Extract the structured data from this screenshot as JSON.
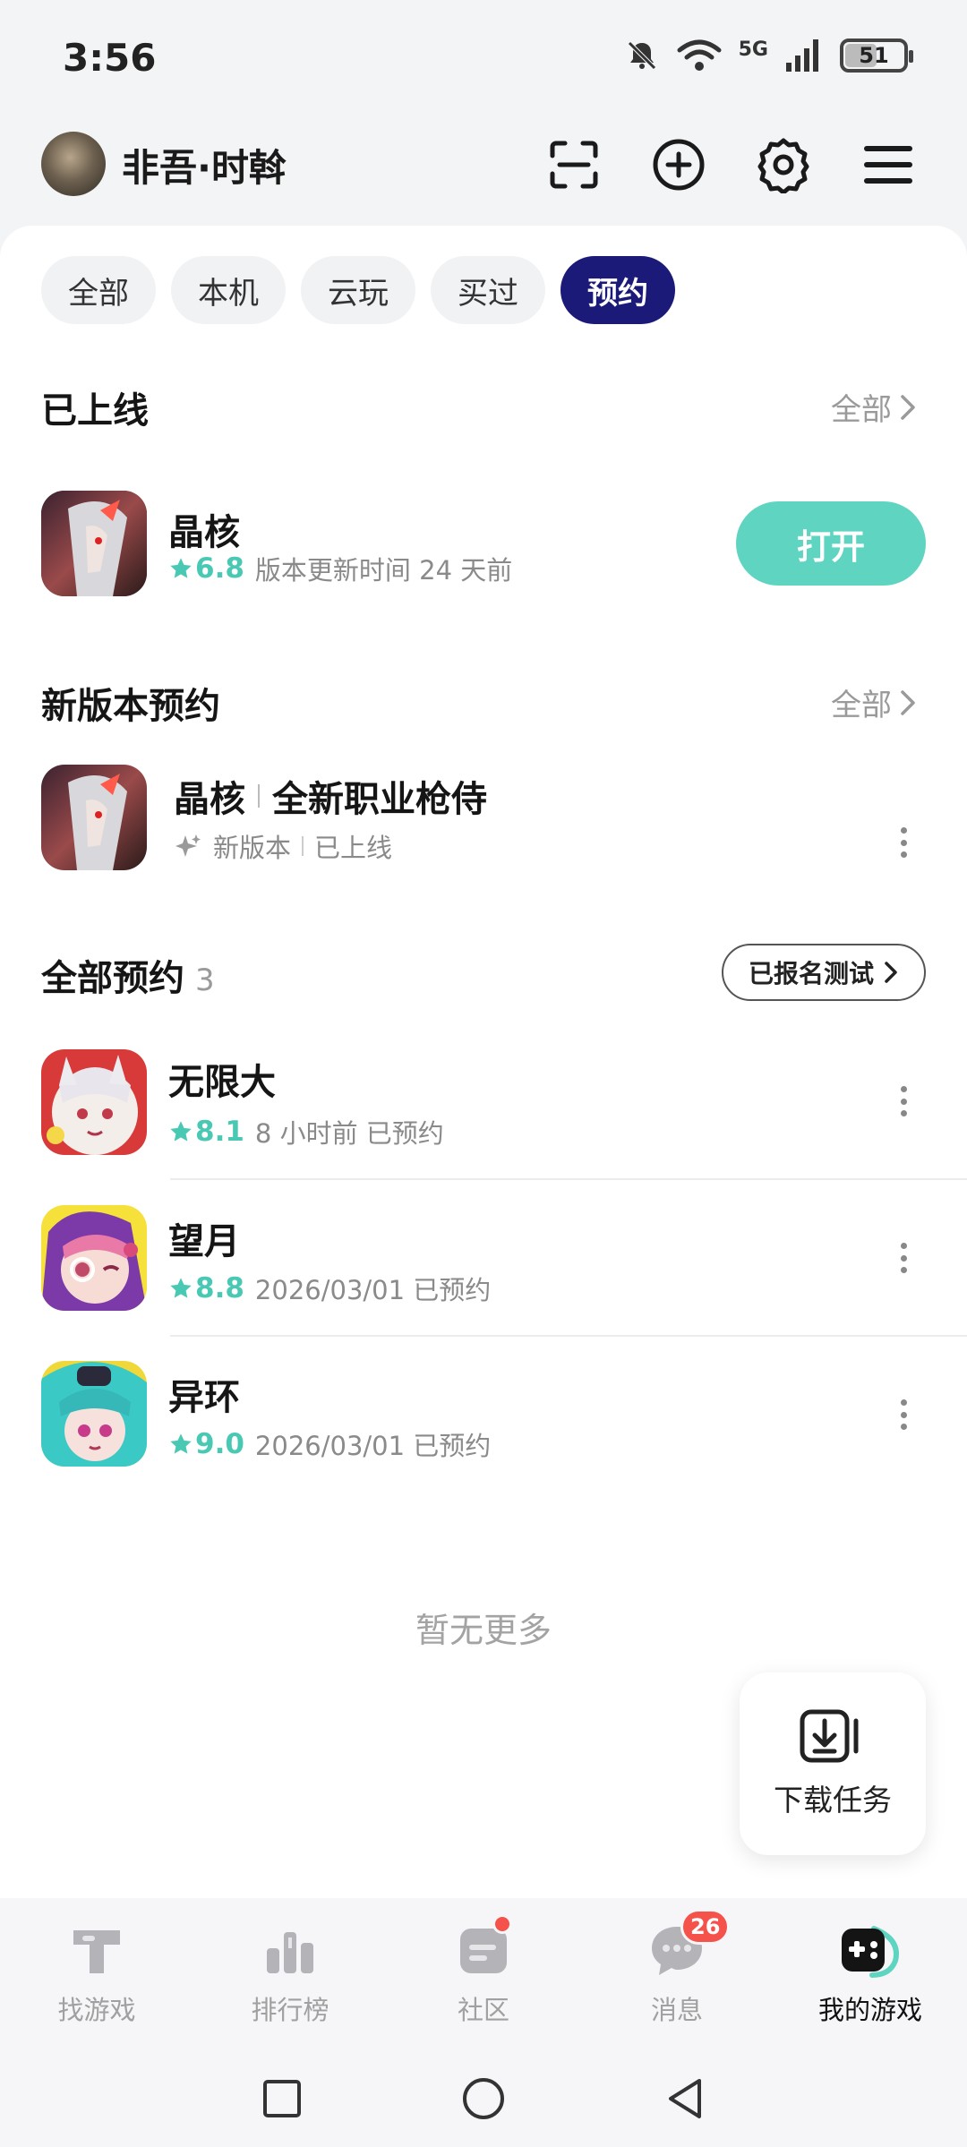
{
  "status_bar": {
    "time": "3:56",
    "network": "5G",
    "battery": "51"
  },
  "header": {
    "user_name": "非吾·时斡"
  },
  "filter_chips": [
    "全部",
    "本机",
    "云玩",
    "买过",
    "预约"
  ],
  "online_section": {
    "title": "已上线",
    "more": "全部",
    "game": {
      "name": "晶核",
      "rating": "6.8",
      "meta": "版本更新时间 24 天前",
      "button": "打开"
    }
  },
  "new_version_section": {
    "title": "新版本预约",
    "more": "全部",
    "game": {
      "name": "晶核",
      "subtitle": "全新职业枪侍",
      "tag1": "新版本",
      "tag2": "已上线"
    }
  },
  "all_reservations": {
    "title": "全部预约",
    "count": "3",
    "signed_button": "已报名测试",
    "games": [
      {
        "name": "无限大",
        "rating": "8.1",
        "meta": "8 小时前 已预约"
      },
      {
        "name": "望月",
        "rating": "8.8",
        "meta": "2026/03/01 已预约"
      },
      {
        "name": "异环",
        "rating": "9.0",
        "meta": "2026/03/01 已预约"
      }
    ]
  },
  "no_more": "暂无更多",
  "download_task": "下载任务",
  "bottom_nav": [
    {
      "label": "找游戏"
    },
    {
      "label": "排行榜"
    },
    {
      "label": "社区"
    },
    {
      "label": "消息",
      "badge": "26"
    },
    {
      "label": "我的游戏"
    }
  ],
  "colors": {
    "accent_teal": "#5fd4c1",
    "active_chip": "#1c1a78",
    "badge_red": "#f4524a"
  }
}
